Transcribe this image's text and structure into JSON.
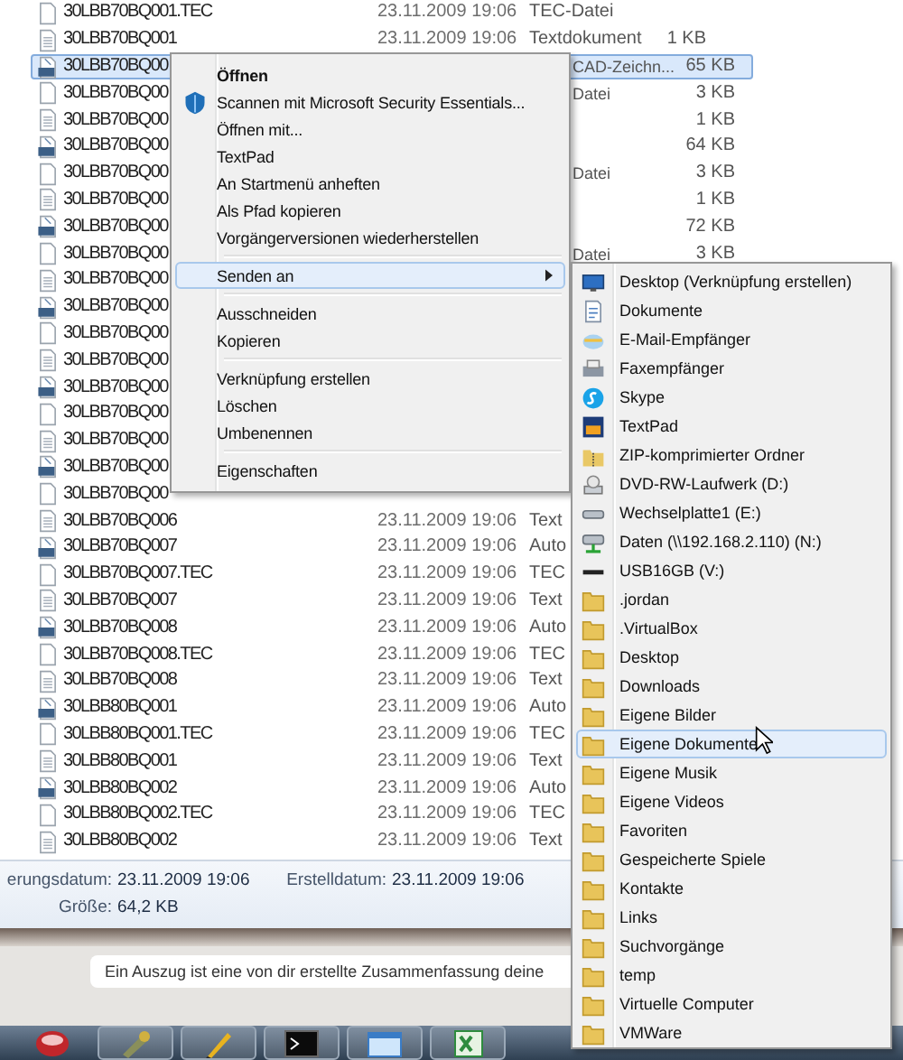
{
  "file_list": {
    "rows": [
      {
        "kind": "blank",
        "name": "30LBB70BQ001.TEC",
        "date": "23.11.2009 19:06",
        "type": "TEC-Datei",
        "selected": false
      },
      {
        "kind": "text",
        "name": "30LBB70BQ001",
        "date": "23.11.2009 19:06",
        "type": "Textdokument",
        "size": "1 KB",
        "selected": false
      },
      {
        "kind": "dxf",
        "name": "30LBB70BQ00",
        "type": "CAD-Zeichn...",
        "size": "65 KB",
        "selected": true
      },
      {
        "kind": "blank",
        "name": "30LBB70BQ00",
        "type": "Datei",
        "size": "3 KB",
        "selected": false
      },
      {
        "kind": "text",
        "name": "30LBB70BQ00",
        "size": "1 KB",
        "selected": false
      },
      {
        "kind": "dxf",
        "name": "30LBB70BQ00",
        "size": "64 KB",
        "selected": false
      },
      {
        "kind": "blank",
        "name": "30LBB70BQ00",
        "type": "Datei",
        "size": "3 KB",
        "selected": false
      },
      {
        "kind": "text",
        "name": "30LBB70BQ00",
        "size": "1 KB",
        "selected": false
      },
      {
        "kind": "dxf",
        "name": "30LBB70BQ00",
        "size": "72 KB",
        "selected": false
      },
      {
        "kind": "blank",
        "name": "30LBB70BQ00",
        "type": "Datei",
        "size": "3 KB",
        "selected": false
      },
      {
        "kind": "text",
        "name": "30LBB70BQ00",
        "selected": false
      },
      {
        "kind": "dxf",
        "name": "30LBB70BQ00",
        "selected": false
      },
      {
        "kind": "blank",
        "name": "30LBB70BQ00",
        "selected": false
      },
      {
        "kind": "text",
        "name": "30LBB70BQ00",
        "selected": false
      },
      {
        "kind": "dxf",
        "name": "30LBB70BQ00",
        "selected": false
      },
      {
        "kind": "blank",
        "name": "30LBB70BQ00",
        "selected": false
      },
      {
        "kind": "text",
        "name": "30LBB70BQ00",
        "selected": false
      },
      {
        "kind": "dxf",
        "name": "30LBB70BQ00",
        "selected": false
      },
      {
        "kind": "blank",
        "name": "30LBB70BQ00",
        "selected": false
      },
      {
        "kind": "text",
        "name": "30LBB70BQ006",
        "date": "23.11.2009 19:06",
        "type": "Text",
        "selected": false
      },
      {
        "kind": "dxf",
        "name": "30LBB70BQ007",
        "date": "23.11.2009 19:06",
        "type": "Auto",
        "selected": false
      },
      {
        "kind": "blank",
        "name": "30LBB70BQ007.TEC",
        "date": "23.11.2009 19:06",
        "type": "TEC",
        "selected": false
      },
      {
        "kind": "text",
        "name": "30LBB70BQ007",
        "date": "23.11.2009 19:06",
        "type": "Text",
        "selected": false
      },
      {
        "kind": "dxf",
        "name": "30LBB70BQ008",
        "date": "23.11.2009 19:06",
        "type": "Auto",
        "selected": false
      },
      {
        "kind": "blank",
        "name": "30LBB70BQ008.TEC",
        "date": "23.11.2009 19:06",
        "type": "TEC",
        "selected": false
      },
      {
        "kind": "text",
        "name": "30LBB70BQ008",
        "date": "23.11.2009 19:06",
        "type": "Text",
        "selected": false
      },
      {
        "kind": "dxf",
        "name": "30LBB80BQ001",
        "date": "23.11.2009 19:06",
        "type": "Auto",
        "selected": false
      },
      {
        "kind": "blank",
        "name": "30LBB80BQ001.TEC",
        "date": "23.11.2009 19:06",
        "type": "TEC",
        "selected": false
      },
      {
        "kind": "text",
        "name": "30LBB80BQ001",
        "date": "23.11.2009 19:06",
        "type": "Text",
        "selected": false
      },
      {
        "kind": "dxf",
        "name": "30LBB80BQ002",
        "date": "23.11.2009 19:06",
        "type": "Auto",
        "selected": false
      },
      {
        "kind": "blank",
        "name": "30LBB80BQ002.TEC",
        "date": "23.11.2009 19:06",
        "type": "TEC",
        "selected": false
      },
      {
        "kind": "text",
        "name": "30LBB80BQ002",
        "date": "23.11.2009 19:06",
        "type": "Text",
        "selected": false
      }
    ]
  },
  "details": [
    {
      "label": "erungsdatum:",
      "value": "23.11.2009 19:06"
    },
    {
      "label": "Erstelldatum:",
      "value": "23.11.2009 19:06"
    },
    {
      "label": "Größe:",
      "value": "64,2 KB"
    }
  ],
  "context_menu": [
    {
      "kind": "item",
      "label": "Öffnen",
      "default": true,
      "has_icon": false,
      "selected": false
    },
    {
      "kind": "item",
      "label": "Scannen mit Microsoft Security Essentials...",
      "default": false,
      "has_icon": true,
      "selected": false
    },
    {
      "kind": "item",
      "label": "Öffnen mit...",
      "default": false,
      "has_icon": false,
      "selected": false
    },
    {
      "kind": "item",
      "label": "TextPad",
      "default": false,
      "has_icon": false,
      "selected": false
    },
    {
      "kind": "item",
      "label": "An Startmenü anheften",
      "default": false,
      "has_icon": false,
      "selected": false
    },
    {
      "kind": "item",
      "label": "Als Pfad kopieren",
      "default": false,
      "has_icon": false,
      "selected": false
    },
    {
      "kind": "item",
      "label": "Vorgängerversionen wiederherstellen",
      "default": false,
      "has_icon": false,
      "selected": false
    },
    {
      "kind": "separator"
    },
    {
      "kind": "submenu",
      "label": "Senden an",
      "default": false,
      "has_icon": false,
      "selected": true
    },
    {
      "kind": "separator"
    },
    {
      "kind": "item",
      "label": "Ausschneiden",
      "default": false,
      "has_icon": false,
      "selected": false
    },
    {
      "kind": "item",
      "label": "Kopieren",
      "default": false,
      "has_icon": false,
      "selected": false
    },
    {
      "kind": "separator"
    },
    {
      "kind": "item",
      "label": "Verknüpfung erstellen",
      "default": false,
      "has_icon": false,
      "selected": false
    },
    {
      "kind": "item",
      "label": "Löschen",
      "default": false,
      "has_icon": false,
      "selected": false
    },
    {
      "kind": "item",
      "label": "Umbenennen",
      "default": false,
      "has_icon": false,
      "selected": false
    },
    {
      "kind": "separator"
    },
    {
      "kind": "item",
      "label": "Eigenschaften",
      "default": false,
      "has_icon": false,
      "selected": false
    }
  ],
  "send_to_menu": [
    {
      "kind": "desktop",
      "label": "Desktop (Verknüpfung erstellen)",
      "selected": false
    },
    {
      "kind": "document",
      "label": "Dokumente",
      "selected": false
    },
    {
      "kind": "mail",
      "label": "E-Mail-Empfänger",
      "selected": false
    },
    {
      "kind": "printer",
      "label": "Faxempfänger",
      "selected": false
    },
    {
      "kind": "chat",
      "label": "Skype",
      "selected": false
    },
    {
      "kind": "editor",
      "label": "TextPad",
      "selected": false
    },
    {
      "kind": "zip",
      "label": "ZIP-komprimierter Ordner",
      "selected": false
    },
    {
      "kind": "disc",
      "label": "DVD-RW-Laufwerk (D:)",
      "selected": false
    },
    {
      "kind": "drive",
      "label": "Wechselplatte1 (E:)",
      "selected": false
    },
    {
      "kind": "network",
      "label": "Daten (\\\\192.168.2.110) (N:)",
      "selected": false
    },
    {
      "kind": "usb",
      "label": "USB16GB (V:)",
      "selected": false
    },
    {
      "kind": "folder",
      "label": ".jordan",
      "selected": false
    },
    {
      "kind": "folder",
      "label": ".VirtualBox",
      "selected": false
    },
    {
      "kind": "folder",
      "label": "Desktop",
      "selected": false
    },
    {
      "kind": "folder",
      "label": "Downloads",
      "selected": false
    },
    {
      "kind": "folder",
      "label": "Eigene Bilder",
      "selected": false
    },
    {
      "kind": "folder",
      "label": "Eigene Dokumente",
      "selected": true
    },
    {
      "kind": "folder",
      "label": "Eigene Musik",
      "selected": false
    },
    {
      "kind": "folder",
      "label": "Eigene Videos",
      "selected": false
    },
    {
      "kind": "folder",
      "label": "Favoriten",
      "selected": false
    },
    {
      "kind": "folder",
      "label": "Gespeicherte Spiele",
      "selected": false
    },
    {
      "kind": "folder",
      "label": "Kontakte",
      "selected": false
    },
    {
      "kind": "folder",
      "label": "Links",
      "selected": false
    },
    {
      "kind": "folder",
      "label": "Suchvorgänge",
      "selected": false
    },
    {
      "kind": "folder",
      "label": "temp",
      "selected": false
    },
    {
      "kind": "folder",
      "label": "Virtuelle Computer",
      "selected": false
    },
    {
      "kind": "folder",
      "label": "VMWare",
      "selected": false
    }
  ],
  "web_page": {
    "excerpt": "Ein Auszug ist eine von dir erstellte Zusammenfassung deine"
  },
  "taskbar": [
    {
      "kind": "badge"
    },
    {
      "kind": "tool"
    },
    {
      "kind": "pen"
    },
    {
      "kind": "terminal"
    },
    {
      "kind": "window"
    },
    {
      "kind": "sheet"
    }
  ]
}
